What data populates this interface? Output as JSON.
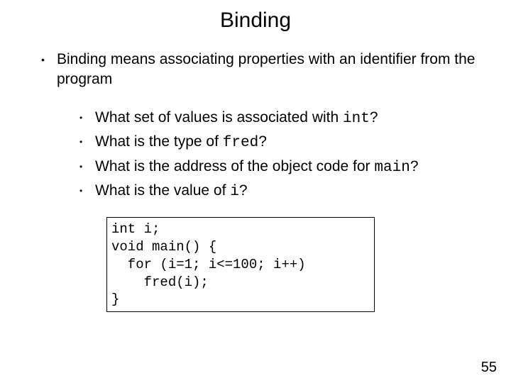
{
  "title": "Binding",
  "main_point": {
    "prefix": "Binding means associating properties with an identifier from the program"
  },
  "sub": [
    {
      "text_before": "What set of values is associated with ",
      "code": "int",
      "text_after": "?"
    },
    {
      "text_before": "What is the type of ",
      "code": "fred",
      "text_after": "?"
    },
    {
      "text_before": "What is the address of the object code for ",
      "code": "main",
      "text_after": "?"
    },
    {
      "text_before": "What is the value of ",
      "code": "i",
      "text_after": "?"
    }
  ],
  "code_lines": [
    "int i;",
    "void main() {",
    "  for (i=1; i<=100; i++)",
    "    fred(i);",
    "}"
  ],
  "page_number": "55"
}
